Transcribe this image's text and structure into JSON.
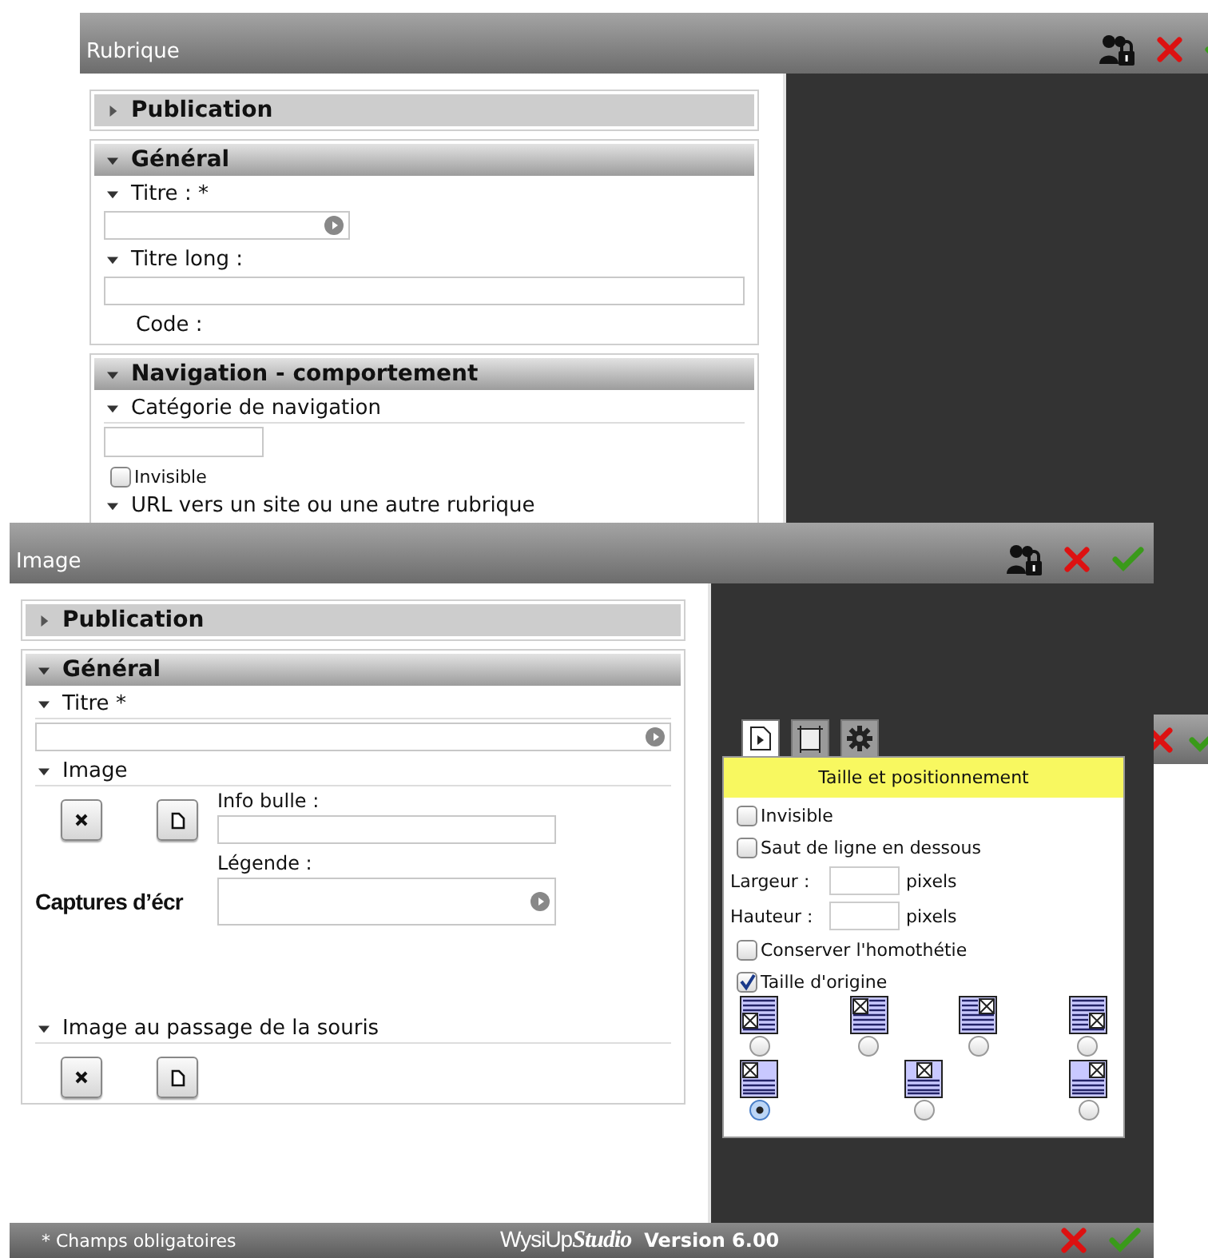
{
  "rubrique_window": {
    "title": "Rubrique",
    "sections": [
      {
        "title": "Publication",
        "expanded": false
      },
      {
        "title": "Général",
        "expanded": true,
        "fields": [
          {
            "kind": "short_input",
            "label": "Titre : *"
          },
          {
            "kind": "long_input",
            "label": "Titre long :"
          },
          {
            "kind": "plain",
            "label": "Code :"
          }
        ]
      },
      {
        "title": "Navigation - comportement",
        "expanded": true,
        "fields": [
          {
            "kind": "category",
            "label": "Catégorie de navigation",
            "checkbox_label": "Invisible",
            "checked": false
          },
          {
            "kind": "heading",
            "label": "URL vers un site ou une autre rubrique"
          }
        ]
      }
    ]
  },
  "image_window": {
    "title": "Image",
    "sections": [
      {
        "title": "Publication",
        "expanded": false
      },
      {
        "title": "Général",
        "expanded": true,
        "fields": [
          {
            "kind": "full_input",
            "label": "Titre *"
          },
          {
            "kind": "image",
            "label": "Image",
            "file_name": "Captures d’écr",
            "tooltip_label": "Info bulle :",
            "caption_label": "Légende :"
          },
          {
            "kind": "buttons",
            "label": "Image au passage de la souris"
          }
        ]
      }
    ],
    "panel": {
      "tabs": [
        {
          "selected": true
        },
        {
          "selected": false
        },
        {
          "selected": false
        }
      ],
      "title": "Taille et positionnement",
      "options": [
        {
          "kind": "checkbox",
          "label": "Invisible",
          "checked": false
        },
        {
          "kind": "checkbox",
          "label": "Saut de ligne en dessous",
          "checked": false
        },
        {
          "kind": "size",
          "label": "Largeur :",
          "unit": "pixels"
        },
        {
          "kind": "size",
          "label": "Hauteur :",
          "unit": "pixels"
        },
        {
          "kind": "checkbox",
          "label": "Conserver l'homothétie",
          "checked": false
        },
        {
          "kind": "checkbox",
          "label": "Taille d'origine",
          "checked": true
        }
      ],
      "alignments": [
        [
          {
            "selected": false
          },
          {
            "selected": false
          },
          {
            "selected": false
          },
          {
            "selected": false
          }
        ],
        [
          {
            "selected": true
          },
          {
            "selected": false
          },
          {
            "selected": false
          }
        ]
      ]
    },
    "footer": {
      "note": "* Champs obligatoires",
      "brand": "WysiUp",
      "brand_suffix": "Studio",
      "version": "Version 6.00"
    }
  }
}
